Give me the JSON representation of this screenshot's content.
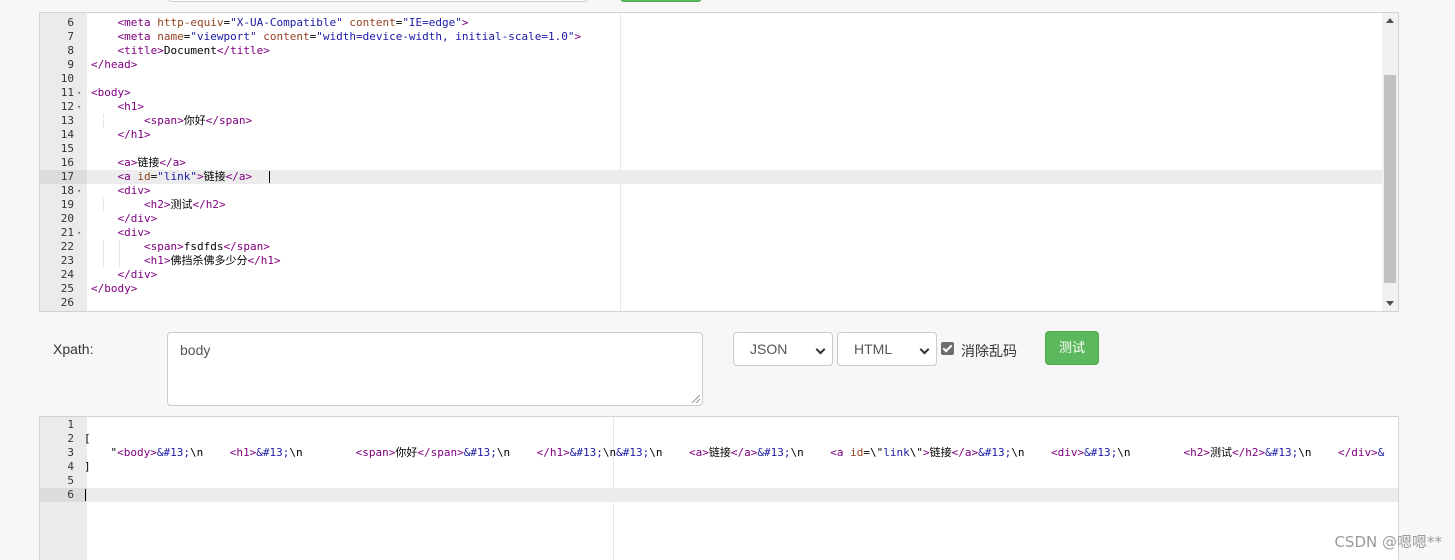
{
  "source_editor": {
    "lines": [
      {
        "n": "6",
        "fold": false,
        "html": "    <span class='tag'>&lt;meta</span> <span class='attr'>http-equiv</span>=<span class='str'>\"X-UA-Compatible\"</span> <span class='attr'>content</span>=<span class='str'>\"IE=edge\"</span><span class='tag'>&gt;</span>"
      },
      {
        "n": "7",
        "fold": false,
        "html": "    <span class='tag'>&lt;meta</span> <span class='attr'>name</span>=<span class='str'>\"viewport\"</span> <span class='attr'>content</span>=<span class='str'>\"width=device-width, initial-scale=1.0\"</span><span class='tag'>&gt;</span>"
      },
      {
        "n": "8",
        "fold": false,
        "html": "    <span class='tag'>&lt;title&gt;</span>Document<span class='tag'>&lt;/title&gt;</span>"
      },
      {
        "n": "9",
        "fold": false,
        "html": "<span class='tag'>&lt;/head&gt;</span>"
      },
      {
        "n": "10",
        "fold": false,
        "html": ""
      },
      {
        "n": "11",
        "fold": true,
        "html": "<span class='tag'>&lt;body&gt;</span>"
      },
      {
        "n": "12",
        "fold": true,
        "html": "    <span class='tag'>&lt;h1&gt;</span>"
      },
      {
        "n": "13",
        "fold": false,
        "html": "        <span class='tag'>&lt;span&gt;</span>你好<span class='tag'>&lt;/span&gt;</span>"
      },
      {
        "n": "14",
        "fold": false,
        "html": "    <span class='tag'>&lt;/h1&gt;</span>"
      },
      {
        "n": "15",
        "fold": false,
        "html": ""
      },
      {
        "n": "16",
        "fold": false,
        "html": "    <span class='tag'>&lt;a&gt;</span>链接<span class='tag'>&lt;/a&gt;</span>"
      },
      {
        "n": "17",
        "fold": false,
        "html": "    <span class='tag'>&lt;a</span> <span class='attr'>id</span>=<span class='str'>\"link\"</span><span class='tag'>&gt;</span>链接<span class='tag'>&lt;/a&gt;</span>"
      },
      {
        "n": "18",
        "fold": true,
        "html": "    <span class='tag'>&lt;div&gt;</span>"
      },
      {
        "n": "19",
        "fold": false,
        "html": "        <span class='tag'>&lt;h2&gt;</span>测试<span class='tag'>&lt;/h2&gt;</span>"
      },
      {
        "n": "20",
        "fold": false,
        "html": "    <span class='tag'>&lt;/div&gt;</span>"
      },
      {
        "n": "21",
        "fold": true,
        "html": "    <span class='tag'>&lt;div&gt;</span>"
      },
      {
        "n": "22",
        "fold": false,
        "html": "        <span class='tag'>&lt;span&gt;</span>fsdfds<span class='tag'>&lt;/span&gt;</span>"
      },
      {
        "n": "23",
        "fold": false,
        "html": "        <span class='tag'>&lt;h1&gt;</span>佛挡杀佛多少分<span class='tag'>&lt;/h1&gt;</span>"
      },
      {
        "n": "24",
        "fold": false,
        "html": "    <span class='tag'>&lt;/div&gt;</span>"
      },
      {
        "n": "25",
        "fold": false,
        "html": "<span class='tag'>&lt;/body&gt;</span>"
      },
      {
        "n": "26",
        "fold": false,
        "html": ""
      }
    ],
    "active_line": "17"
  },
  "form": {
    "xpath_label": "Xpath:",
    "xpath_value": "body",
    "format_select": "JSON",
    "type_select": "HTML",
    "checkbox_label": "消除乱码",
    "checkbox_checked": true,
    "test_button": "测试"
  },
  "result_editor": {
    "lines": [
      {
        "n": "1",
        "html": ""
      },
      {
        "n": "2",
        "html": "["
      },
      {
        "n": "3",
        "html": "    \"<span class='tag'>&lt;body&gt;</span><span class='ent'>&amp;#13;</span>\\n    <span class='tag'>&lt;h1&gt;</span><span class='ent'>&amp;#13;</span>\\n        <span class='tag'>&lt;span&gt;</span>你好<span class='tag'>&lt;/span&gt;</span><span class='ent'>&amp;#13;</span>\\n    <span class='tag'>&lt;/h1&gt;</span><span class='ent'>&amp;#13;</span>\\n<span class='ent'>&amp;#13;</span>\\n    <span class='tag'>&lt;a&gt;</span>链接<span class='tag'>&lt;/a&gt;</span><span class='ent'>&amp;#13;</span>\\n    <span class='tag'>&lt;a</span> <span class='attr'>id</span>=\\\"<span class='str'>link</span>\\\"<span class='tag'>&gt;</span>链接<span class='tag'>&lt;/a&gt;</span><span class='ent'>&amp;#13;</span>\\n    <span class='tag'>&lt;div&gt;</span><span class='ent'>&amp;#13;</span>\\n        <span class='tag'>&lt;h2&gt;</span>测试<span class='tag'>&lt;/h2&gt;</span><span class='ent'>&amp;#13;</span>\\n    <span class='tag'>&lt;/div&gt;</span><span class='ent'>&amp;</span>"
      },
      {
        "n": "4",
        "html": "]"
      },
      {
        "n": "5",
        "html": ""
      },
      {
        "n": "6",
        "html": ""
      }
    ],
    "active_line": "6"
  },
  "watermark": "CSDN @嗯嗯**"
}
